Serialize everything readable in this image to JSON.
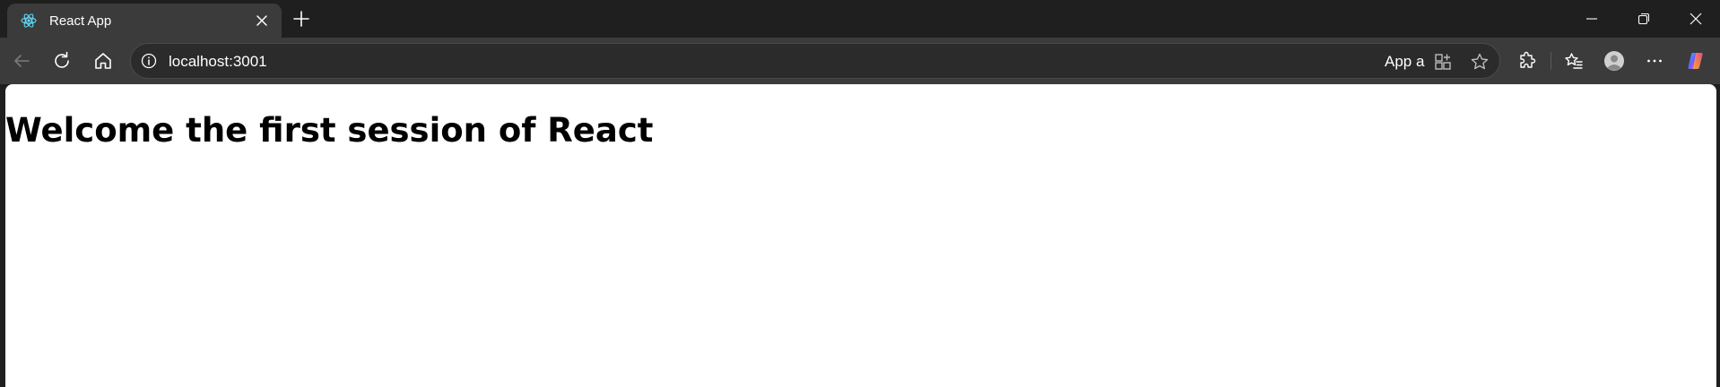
{
  "tab": {
    "title": "React App",
    "favicon": "react-logo-icon"
  },
  "address_bar": {
    "url": "localhost:3001",
    "app_available_label": "App a"
  },
  "page": {
    "heading": "Welcome the first session of React"
  },
  "icons": {
    "tab_close": "close-icon",
    "new_tab": "plus-icon",
    "minimize": "minimize-icon",
    "restore": "restore-icon",
    "window_close": "close-icon",
    "back": "arrow-left-icon",
    "reload": "reload-icon",
    "home": "home-icon",
    "site_info": "info-icon",
    "app_install": "app-install-icon",
    "favorite": "star-icon",
    "extensions": "puzzle-icon",
    "favorites": "favorites-icon",
    "profile": "avatar-icon",
    "more": "more-horizontal-icon",
    "copilot": "copilot-icon"
  },
  "colors": {
    "frame": "#1f1f1f",
    "toolbar": "#3b3b3b",
    "react_cyan": "#61dafb",
    "page_background": "#ffffff"
  }
}
